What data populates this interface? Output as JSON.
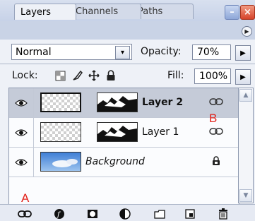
{
  "window": {
    "minimize_glyph": "–",
    "close_glyph": "×"
  },
  "tabs": [
    {
      "label": "Layers",
      "active": true
    },
    {
      "label": "Channels",
      "active": false
    },
    {
      "label": "Paths",
      "active": false
    }
  ],
  "panel_menu_glyph": "▶",
  "blend": {
    "value": "Normal",
    "arrow": "▾"
  },
  "opacity": {
    "label": "Opacity:",
    "value": "70%",
    "arrow": "▶"
  },
  "lock": {
    "label": "Lock:",
    "icons": [
      "lock-transparent-pixels-icon",
      "lock-image-pixels-icon",
      "lock-position-icon",
      "lock-all-icon"
    ]
  },
  "fill": {
    "label": "Fill:",
    "value": "100%",
    "arrow": "▶"
  },
  "layers": [
    {
      "name": "Layer 2",
      "selected": true,
      "linked": true
    },
    {
      "name": "Layer 1",
      "selected": false,
      "linked": true
    },
    {
      "name": "Background",
      "selected": false,
      "locked": true
    }
  ],
  "annotations": {
    "a": "A",
    "b": "B"
  },
  "toolbar_icons": [
    "link-layers-icon",
    "layer-style-icon",
    "layer-mask-icon",
    "adjustment-layer-icon",
    "new-group-icon",
    "new-layer-icon",
    "delete-layer-icon"
  ],
  "colors": {
    "annotation": "#e2221a",
    "selected_row": "#c5cbd8",
    "panel_bg": "#eef1f7"
  }
}
